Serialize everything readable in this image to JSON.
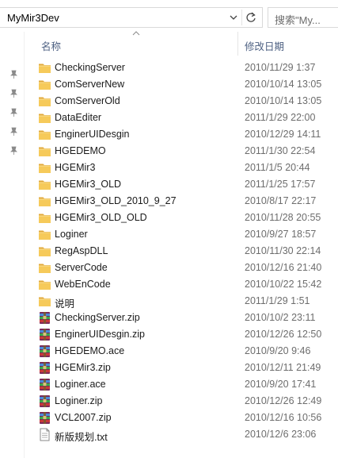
{
  "address": {
    "path": "MyMir3Dev"
  },
  "search": {
    "placeholder": "搜索\"My..."
  },
  "columns": {
    "name": "名称",
    "date": "修改日期"
  },
  "items": [
    {
      "name": "CheckingServer",
      "date": "2010/11/29 1:37",
      "type": "folder"
    },
    {
      "name": "ComServerNew",
      "date": "2010/10/14 13:05",
      "type": "folder"
    },
    {
      "name": "ComServerOld",
      "date": "2010/10/14 13:05",
      "type": "folder"
    },
    {
      "name": "DataEditer",
      "date": "2011/1/29 22:00",
      "type": "folder"
    },
    {
      "name": "EnginerUIDesgin",
      "date": "2010/12/29 14:11",
      "type": "folder"
    },
    {
      "name": "HGEDEMO",
      "date": "2011/1/30 22:54",
      "type": "folder"
    },
    {
      "name": "HGEMir3",
      "date": "2011/1/5 20:44",
      "type": "folder"
    },
    {
      "name": "HGEMir3_OLD",
      "date": "2011/1/25 17:57",
      "type": "folder"
    },
    {
      "name": "HGEMir3_OLD_2010_9_27",
      "date": "2010/8/17 22:17",
      "type": "folder"
    },
    {
      "name": "HGEMir3_OLD_OLD",
      "date": "2010/11/28 20:55",
      "type": "folder"
    },
    {
      "name": "Loginer",
      "date": "2010/9/27 18:57",
      "type": "folder"
    },
    {
      "name": "RegAspDLL",
      "date": "2010/11/30 22:14",
      "type": "folder"
    },
    {
      "name": "ServerCode",
      "date": "2010/12/16 21:40",
      "type": "folder"
    },
    {
      "name": "WebEnCode",
      "date": "2010/10/22 15:42",
      "type": "folder"
    },
    {
      "name": "说明",
      "date": "2011/1/29 1:51",
      "type": "folder"
    },
    {
      "name": "CheckingServer.zip",
      "date": "2010/10/2 23:11",
      "type": "archive"
    },
    {
      "name": "EnginerUIDesgin.zip",
      "date": "2010/12/26 12:50",
      "type": "archive"
    },
    {
      "name": "HGEDEMO.ace",
      "date": "2010/9/20 9:46",
      "type": "archive"
    },
    {
      "name": "HGEMir3.zip",
      "date": "2010/12/11 21:49",
      "type": "archive"
    },
    {
      "name": "Loginer.ace",
      "date": "2010/9/20 17:41",
      "type": "archive"
    },
    {
      "name": "Loginer.zip",
      "date": "2010/12/26 12:49",
      "type": "archive"
    },
    {
      "name": "VCL2007.zip",
      "date": "2010/12/16 10:56",
      "type": "archive"
    },
    {
      "name": "新版规划.txt",
      "date": "2010/12/6 23:06",
      "type": "text"
    }
  ],
  "icons": {
    "folder": "folder-icon",
    "archive": "winrar-archive-icon",
    "text": "text-file-icon",
    "pin": "pin-icon",
    "refresh": "refresh-icon",
    "dropdown": "chevron-down-icon",
    "sort": "sort-ascending-icon"
  },
  "colors": {
    "folder": "#f0c44c",
    "header_text": "#4d6082",
    "date_text": "#6d6d6d"
  }
}
